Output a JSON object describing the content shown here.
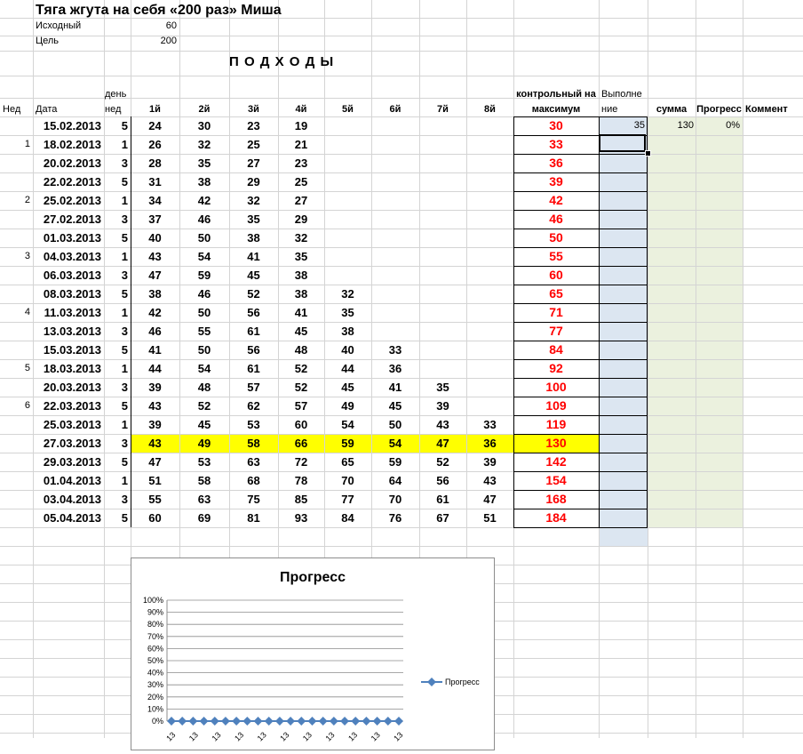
{
  "title": "Тяга жгута на себя «200 раз» Миша",
  "params": [
    {
      "label": "Исходный",
      "value": "60"
    },
    {
      "label": "Цель",
      "value": "200"
    }
  ],
  "section_title": "П О Д Х О Д Ы",
  "headers": {
    "week": "Нед",
    "date": "Дата",
    "day_line1": "день",
    "day_line2": "нед",
    "sets": [
      "1й",
      "2й",
      "3й",
      "4й",
      "5й",
      "6й",
      "7й",
      "8й"
    ],
    "control_line1": "контрольный на",
    "control_line2": "максимум",
    "done_line1": "Выполне",
    "done_line2": "ние",
    "sum": "сумма",
    "progress": "Прогресс",
    "comment": "Коммент"
  },
  "first_row_extra": {
    "done": "35",
    "sum": "130",
    "progress": "0%"
  },
  "rows": [
    {
      "week": "",
      "date": "15.02.2013",
      "day": "5",
      "sets": [
        "24",
        "30",
        "23",
        "19",
        "",
        "",
        "",
        ""
      ],
      "control": "30",
      "highlight": false
    },
    {
      "week": "1",
      "date": "18.02.2013",
      "day": "1",
      "sets": [
        "26",
        "32",
        "25",
        "21",
        "",
        "",
        "",
        ""
      ],
      "control": "33",
      "highlight": false
    },
    {
      "week": "",
      "date": "20.02.2013",
      "day": "3",
      "sets": [
        "28",
        "35",
        "27",
        "23",
        "",
        "",
        "",
        ""
      ],
      "control": "36",
      "highlight": false
    },
    {
      "week": "",
      "date": "22.02.2013",
      "day": "5",
      "sets": [
        "31",
        "38",
        "29",
        "25",
        "",
        "",
        "",
        ""
      ],
      "control": "39",
      "highlight": false
    },
    {
      "week": "2",
      "date": "25.02.2013",
      "day": "1",
      "sets": [
        "34",
        "42",
        "32",
        "27",
        "",
        "",
        "",
        ""
      ],
      "control": "42",
      "highlight": false
    },
    {
      "week": "",
      "date": "27.02.2013",
      "day": "3",
      "sets": [
        "37",
        "46",
        "35",
        "29",
        "",
        "",
        "",
        ""
      ],
      "control": "46",
      "highlight": false
    },
    {
      "week": "",
      "date": "01.03.2013",
      "day": "5",
      "sets": [
        "40",
        "50",
        "38",
        "32",
        "",
        "",
        "",
        ""
      ],
      "control": "50",
      "highlight": false
    },
    {
      "week": "3",
      "date": "04.03.2013",
      "day": "1",
      "sets": [
        "43",
        "54",
        "41",
        "35",
        "",
        "",
        "",
        ""
      ],
      "control": "55",
      "highlight": false
    },
    {
      "week": "",
      "date": "06.03.2013",
      "day": "3",
      "sets": [
        "47",
        "59",
        "45",
        "38",
        "",
        "",
        "",
        ""
      ],
      "control": "60",
      "highlight": false
    },
    {
      "week": "",
      "date": "08.03.2013",
      "day": "5",
      "sets": [
        "38",
        "46",
        "52",
        "38",
        "32",
        "",
        "",
        ""
      ],
      "control": "65",
      "highlight": false
    },
    {
      "week": "4",
      "date": "11.03.2013",
      "day": "1",
      "sets": [
        "42",
        "50",
        "56",
        "41",
        "35",
        "",
        "",
        ""
      ],
      "control": "71",
      "highlight": false
    },
    {
      "week": "",
      "date": "13.03.2013",
      "day": "3",
      "sets": [
        "46",
        "55",
        "61",
        "45",
        "38",
        "",
        "",
        ""
      ],
      "control": "77",
      "highlight": false
    },
    {
      "week": "",
      "date": "15.03.2013",
      "day": "5",
      "sets": [
        "41",
        "50",
        "56",
        "48",
        "40",
        "33",
        "",
        ""
      ],
      "control": "84",
      "highlight": false
    },
    {
      "week": "5",
      "date": "18.03.2013",
      "day": "1",
      "sets": [
        "44",
        "54",
        "61",
        "52",
        "44",
        "36",
        "",
        ""
      ],
      "control": "92",
      "highlight": false
    },
    {
      "week": "",
      "date": "20.03.2013",
      "day": "3",
      "sets": [
        "39",
        "48",
        "57",
        "52",
        "45",
        "41",
        "35",
        ""
      ],
      "control": "100",
      "highlight": false
    },
    {
      "week": "6",
      "date": "22.03.2013",
      "day": "5",
      "sets": [
        "43",
        "52",
        "62",
        "57",
        "49",
        "45",
        "39",
        ""
      ],
      "control": "109",
      "highlight": false
    },
    {
      "week": "",
      "date": "25.03.2013",
      "day": "1",
      "sets": [
        "39",
        "45",
        "53",
        "60",
        "54",
        "50",
        "43",
        "33"
      ],
      "control": "119",
      "highlight": false
    },
    {
      "week": "",
      "date": "27.03.2013",
      "day": "3",
      "sets": [
        "43",
        "49",
        "58",
        "66",
        "59",
        "54",
        "47",
        "36"
      ],
      "control": "130",
      "highlight": true
    },
    {
      "week": "",
      "date": "29.03.2013",
      "day": "5",
      "sets": [
        "47",
        "53",
        "63",
        "72",
        "65",
        "59",
        "52",
        "39"
      ],
      "control": "142",
      "highlight": false
    },
    {
      "week": "",
      "date": "01.04.2013",
      "day": "1",
      "sets": [
        "51",
        "58",
        "68",
        "78",
        "70",
        "64",
        "56",
        "43"
      ],
      "control": "154",
      "highlight": false
    },
    {
      "week": "",
      "date": "03.04.2013",
      "day": "3",
      "sets": [
        "55",
        "63",
        "75",
        "85",
        "77",
        "70",
        "61",
        "47"
      ],
      "control": "168",
      "highlight": false
    },
    {
      "week": "",
      "date": "05.04.2013",
      "day": "5",
      "sets": [
        "60",
        "69",
        "81",
        "93",
        "84",
        "76",
        "67",
        "51"
      ],
      "control": "184",
      "highlight": false
    }
  ],
  "colors": {
    "control_text": "#ff0000",
    "highlight": "#ffff00",
    "done_fill": "#dce6f1",
    "sum_fill": "#ebf1de",
    "series": "#4f81bd",
    "selection": "#000000"
  },
  "chart_data": {
    "type": "line",
    "title": "Прогресс",
    "series": [
      {
        "name": "Прогресс",
        "values": [
          0,
          0,
          0,
          0,
          0,
          0,
          0,
          0,
          0,
          0,
          0,
          0,
          0,
          0,
          0,
          0,
          0,
          0,
          0,
          0,
          0,
          0
        ]
      }
    ],
    "y_ticks": [
      "0%",
      "10%",
      "20%",
      "30%",
      "40%",
      "50%",
      "60%",
      "70%",
      "80%",
      "90%",
      "100%"
    ],
    "ylim": [
      0,
      1
    ],
    "x_tick_labels_visible": [
      "13",
      "13",
      "13",
      "13",
      "13",
      "13",
      "13",
      "13",
      "13",
      "13",
      "13"
    ],
    "legend": "right",
    "grid": true
  }
}
